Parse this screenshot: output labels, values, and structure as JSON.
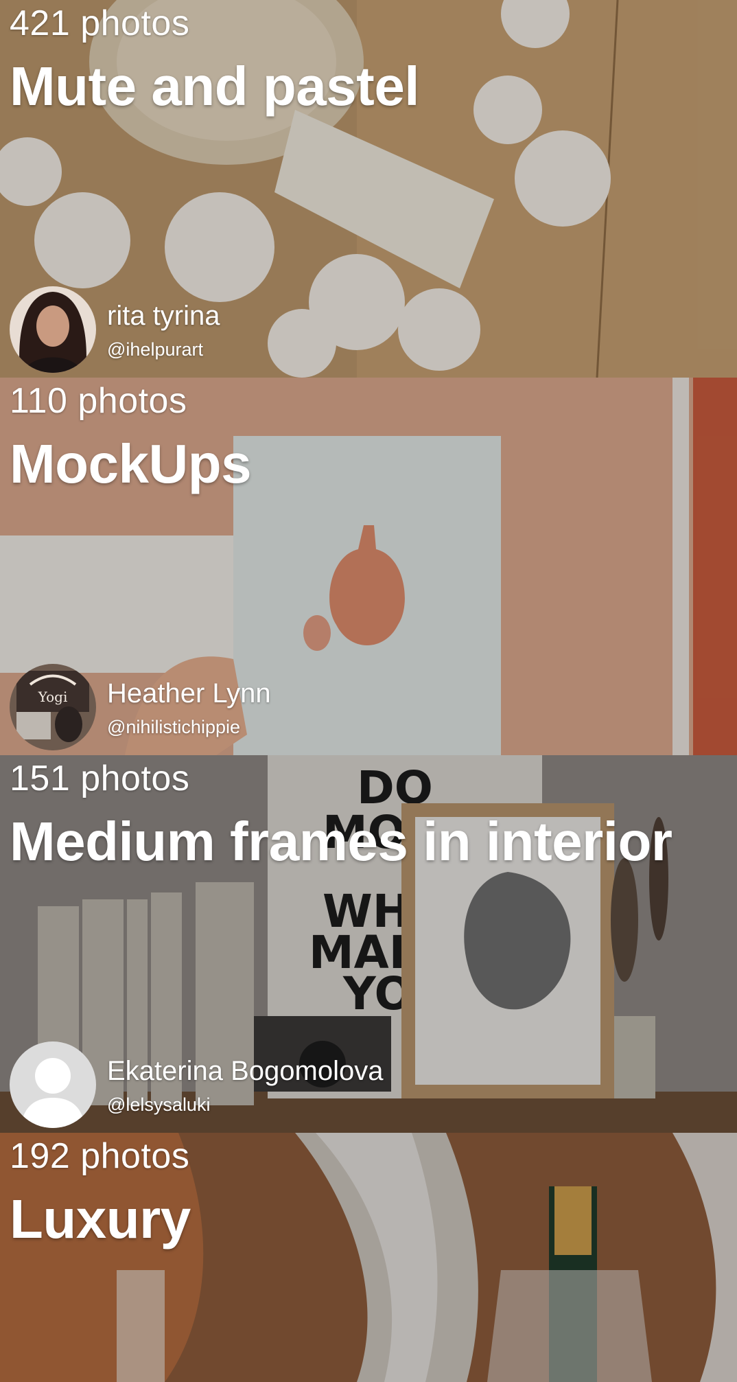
{
  "collections": [
    {
      "photo_count": "421 photos",
      "title": "Mute and pastel",
      "author_name": "rita tyrina",
      "author_handle": "@ihelpurart",
      "avatar": "profile-photo-icon",
      "accent": "#c9a97e"
    },
    {
      "photo_count": "110 photos",
      "title": "MockUps",
      "author_name": "Heather Lynn",
      "author_handle": "@nihilistichippie",
      "avatar": "profile-photo-icon",
      "accent": "#d39a7c"
    },
    {
      "photo_count": "151 photos",
      "title": "Medium frames in interior",
      "author_name": "Ekaterina Bogomolova",
      "author_handle": "@lelsysaluki",
      "avatar": "default-user-icon",
      "accent": "#6f6a66"
    },
    {
      "photo_count": "192 photos",
      "title": "Luxury",
      "author_name": "",
      "author_handle": "",
      "avatar": "",
      "accent": "#a0643e"
    }
  ]
}
